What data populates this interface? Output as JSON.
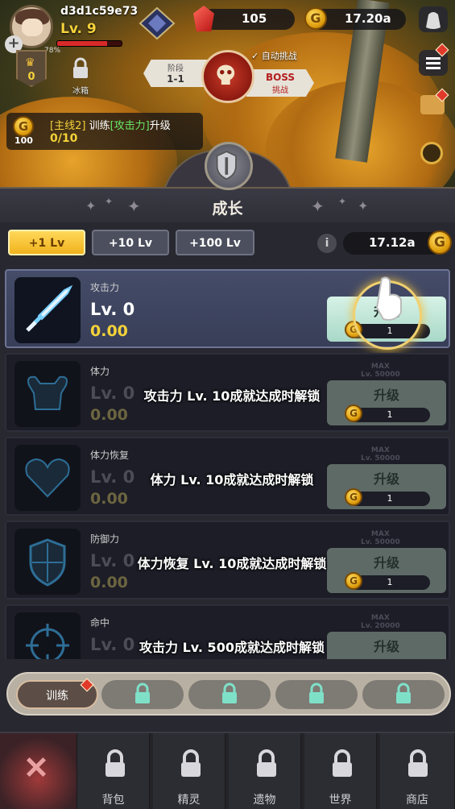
{
  "player": {
    "name": "d3d1c59e73",
    "level": "Lv. 9",
    "hp_percent": "78%",
    "hp_fraction": 0.78,
    "rank_value": "0",
    "locked_feature_label": "冰箱"
  },
  "currency": {
    "gems": "105",
    "gold": "17.20a"
  },
  "stage": {
    "label": "阶段",
    "value": "1-1",
    "auto_battle": "自动挑战",
    "boss_title": "BOSS",
    "boss_sub": "挑战"
  },
  "quest": {
    "prefix": "[主线2]",
    "verb": "训练",
    "highlight": "[攻击力]",
    "suffix": "升级",
    "progress": "0/10",
    "reward": "100"
  },
  "panel": {
    "title": "成长",
    "balance": "17.12a"
  },
  "level_buttons": [
    "+1 Lv",
    "+10 Lv",
    "+100 Lv"
  ],
  "info_icon": "i",
  "stats": [
    {
      "name": "攻击力",
      "level": "Lv. 0",
      "value": "0.00",
      "button": "升级",
      "cost": "1",
      "max": "",
      "lock": "",
      "icon": "dagger-icon"
    },
    {
      "name": "体力",
      "level": "Lv. 0",
      "value": "0.00",
      "button": "升级",
      "cost": "1",
      "max": "MAX\nLv. 50000",
      "lock": "攻击力 Lv. 10成就达成时解锁",
      "icon": "muscle-icon"
    },
    {
      "name": "体力恢复",
      "level": "Lv. 0",
      "value": "0.00",
      "button": "升级",
      "cost": "1",
      "max": "MAX\nLv. 50000",
      "lock": "体力  Lv. 10成就达成时解锁",
      "icon": "heart-icon"
    },
    {
      "name": "防御力",
      "level": "Lv. 0",
      "value": "0.00",
      "button": "升级",
      "cost": "1",
      "max": "MAX\nLv. 50000",
      "lock": "体力恢复 Lv. 10成就达成时解锁",
      "icon": "shield-icon"
    },
    {
      "name": "命中",
      "level": "Lv. 0",
      "value": "0.00",
      "button": "升级",
      "cost": "1",
      "max": "MAX\nLv. 20000",
      "lock": "攻击力 Lv. 500成就达成时解锁",
      "icon": "crosshair-icon"
    }
  ],
  "sub_tabs": [
    "训练",
    "",
    "",
    "",
    ""
  ],
  "nav": [
    {
      "label": "",
      "icon": "close-icon"
    },
    {
      "label": "背包",
      "icon": "lock-icon"
    },
    {
      "label": "精灵",
      "icon": "lock-icon"
    },
    {
      "label": "遗物",
      "icon": "lock-icon"
    },
    {
      "label": "世界",
      "icon": "lock-icon"
    },
    {
      "label": "商店",
      "icon": "lock-icon"
    }
  ],
  "colors": {
    "accent_gold": "#f4d23a",
    "highlight_green": "#66e866",
    "boss_red": "#b31e1e",
    "button_yellow": "#f0b21c"
  }
}
